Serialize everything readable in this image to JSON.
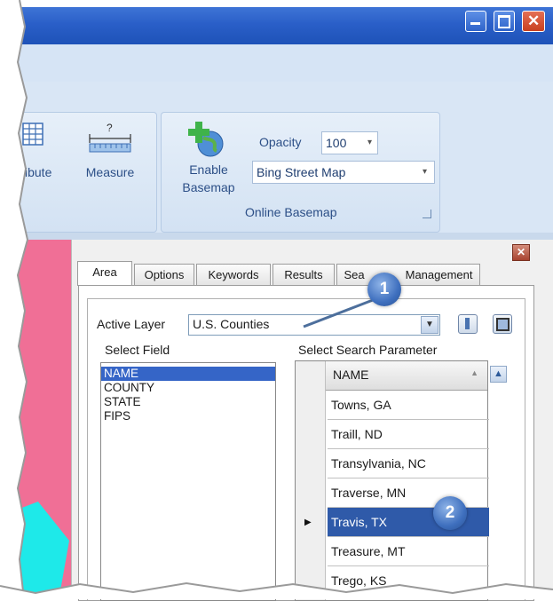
{
  "ribbon": {
    "attribute_label_fragment": "ibute",
    "measure_label": "Measure",
    "enable_basemap_line1": "Enable",
    "enable_basemap_line2": "Basemap",
    "opacity_label": "Opacity",
    "opacity_value": "100",
    "basemap_value": "Bing Street Map",
    "group_label": "Online Basemap"
  },
  "search_panel": {
    "tabs": [
      "Area",
      "Options",
      "Keywords",
      "Results",
      "Sea",
      "Management"
    ],
    "active_layer_label": "Active Layer",
    "active_layer_value": "U.S. Counties",
    "select_field_label": "Select Field",
    "select_param_label": "Select Search Parameter",
    "fields": [
      "NAME",
      "COUNTY",
      "STATE",
      "FIPS"
    ],
    "grid_header": "NAME",
    "rows": [
      "Towns, GA",
      "Traill, ND",
      "Transylvania, NC",
      "Traverse, MN",
      "Travis, TX",
      "Treasure, MT",
      "Trego, KS"
    ]
  },
  "callouts": {
    "first": "1",
    "second": "2"
  },
  "icons": [
    "minimize-icon",
    "maximize-icon",
    "close-icon",
    "attribute-table-icon",
    "measure-icon",
    "enable-basemap-icon",
    "dropdown-arrow-icon",
    "panel-close-icon",
    "zoom-icon",
    "extent-icon",
    "row-pointer-icon",
    "sort-asc-icon",
    "scroll-up-icon"
  ],
  "colors": {
    "titlebar": "#2a5fc8",
    "ribbon": "#d9e6f5",
    "selection": "#2f5aa9",
    "map_pink": "#f06f96",
    "map_cyan": "#1ee9e9",
    "close_red": "#c8401f"
  }
}
